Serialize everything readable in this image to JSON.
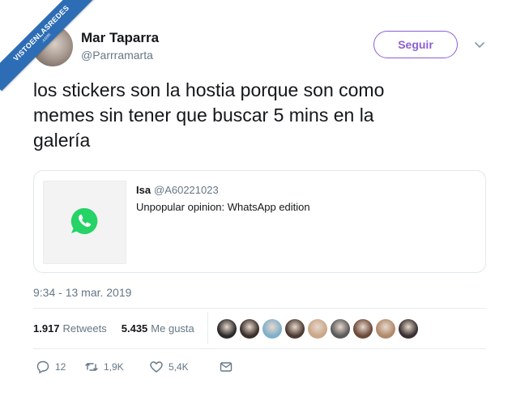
{
  "watermark": {
    "text": "VISTOENLASREDES",
    "suffix": ".com"
  },
  "user": {
    "name": "Mar Taparra",
    "handle": "@Parrramarta"
  },
  "follow_button": {
    "label": "Seguir"
  },
  "tweet": {
    "lines": [
      "los stickers son la hostia porque son como",
      "memes sin tener que buscar 5 mins en la",
      "galería"
    ],
    "timestamp": "9:34 - 13 mar. 2019"
  },
  "quote": {
    "name": "Isa",
    "handle": "@A60221023",
    "text": "Unpopular opinion: WhatsApp edition"
  },
  "stats": {
    "retweets_count": "1.917",
    "retweets_label": "Retweets",
    "likes_count": "5.435",
    "likes_label": "Me gusta"
  },
  "liker_faces": [
    {
      "color": "#2a2a2a"
    },
    {
      "color": "#3b2f2a"
    },
    {
      "color": "#7fb0c9"
    },
    {
      "color": "#4a3a32"
    },
    {
      "color": "#c9a78a"
    },
    {
      "color": "#5a5a5a"
    },
    {
      "color": "#6b4a3a"
    },
    {
      "color": "#b08a6a"
    },
    {
      "color": "#3a3030"
    }
  ],
  "actions": {
    "replies": "12",
    "retweets": "1,9K",
    "likes": "5,4K"
  },
  "colors": {
    "accent": "#8b5fd6",
    "whatsapp": "#25d366",
    "ribbon": "#2d6db5",
    "muted": "#657786"
  }
}
